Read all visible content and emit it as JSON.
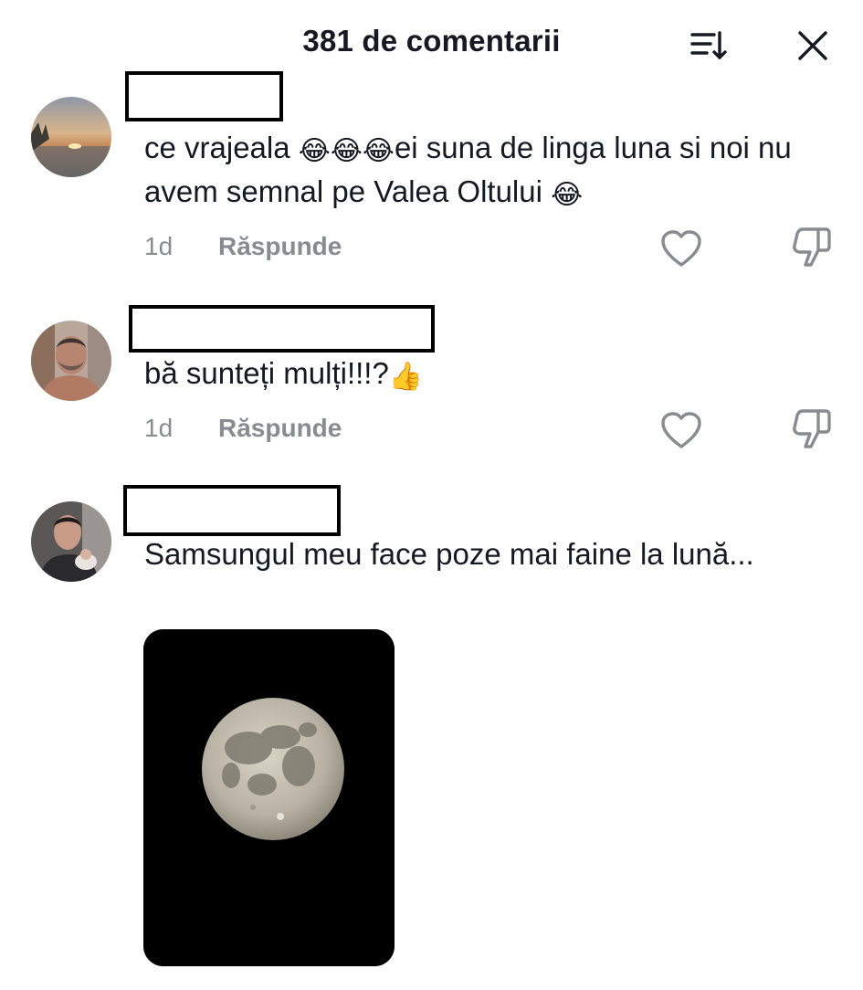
{
  "header": {
    "title": "381 de comentarii",
    "sort_icon": "sort-icon",
    "close_icon": "close-icon"
  },
  "comments": [
    {
      "text_before_emoji": "ce vrajeala ",
      "emoji_block": "😂😂😂",
      "text_after_emoji": "ei suna de linga luna si noi nu avem semnal pe Valea Oltului ",
      "trailing_emoji": "😂",
      "time": "1d",
      "reply_label": "Răspunde",
      "avatar_icon": "sunset-avatar"
    },
    {
      "text": "bă sunteți mulți!!!?",
      "trailing_emoji": "👍",
      "time": "1d",
      "reply_label": "Răspunde",
      "avatar_icon": "man-avatar"
    },
    {
      "text": "Samsungul meu face poze mai faine la lună...",
      "avatar_icon": "man-with-baby-avatar",
      "attachment": "moon-photo"
    }
  ],
  "colors": {
    "text": "#161823",
    "muted": "#8a8b91",
    "photo_bg": "#000000"
  }
}
